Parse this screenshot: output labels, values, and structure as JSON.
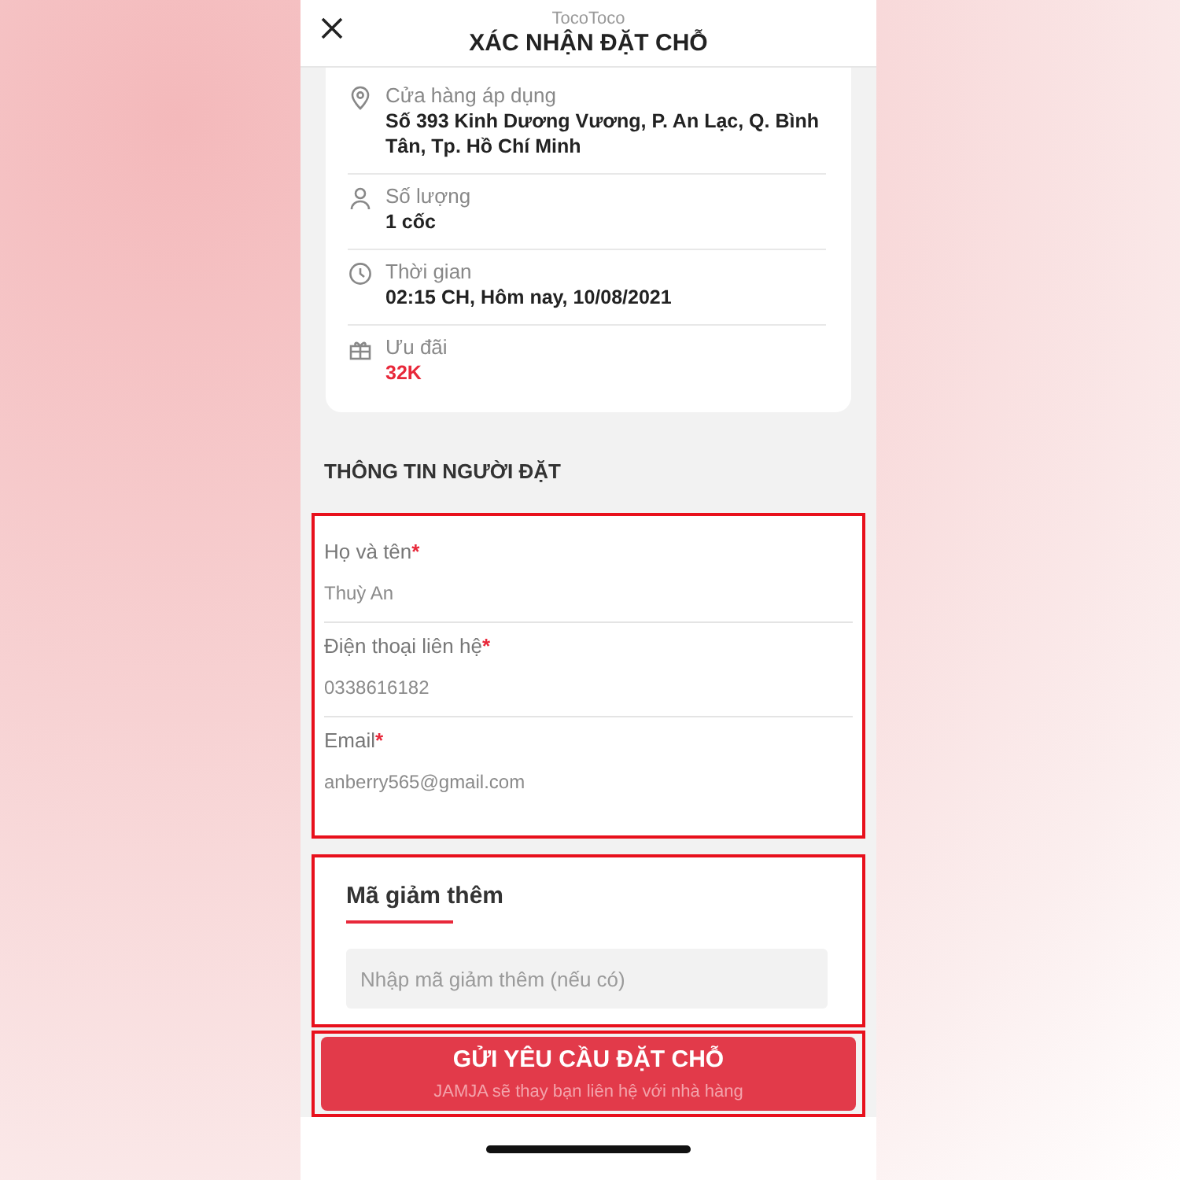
{
  "header": {
    "brand": "TocoToco",
    "title": "XÁC NHẬN ĐẶT CHỖ"
  },
  "details": [
    {
      "kind": "store",
      "label": "Cửa hàng áp dụng",
      "value": "Số 393 Kinh Dương Vương, P. An Lạc, Q. Bình Tân, Tp. Hồ Chí Minh",
      "emphasis": false
    },
    {
      "kind": "quantity",
      "label": "Số lượng",
      "value": "1 cốc",
      "emphasis": false
    },
    {
      "kind": "time",
      "label": "Thời gian",
      "value": "02:15 CH, Hôm nay, 10/08/2021",
      "emphasis": false
    },
    {
      "kind": "offer",
      "label": "Ưu đãi",
      "value": "32K",
      "emphasis": true
    }
  ],
  "contact": {
    "heading": "THÔNG TIN NGƯỜI ĐẶT",
    "fields": [
      {
        "label": "Họ và tên",
        "required_mark": "*",
        "value": "Thuỳ An"
      },
      {
        "label": "Điện thoại liên hệ",
        "required_mark": "*",
        "value": "0338616182"
      },
      {
        "label": "Email",
        "required_mark": "*",
        "value": "anberry565@gmail.com"
      }
    ]
  },
  "promo": {
    "title": "Mã giảm thêm",
    "placeholder": "Nhập mã giảm thêm (nếu có)"
  },
  "submit": {
    "label": "GỬI YÊU CẦU ĐẶT CHỖ",
    "note": "JAMJA sẽ thay bạn liên hệ với nhà hàng"
  }
}
